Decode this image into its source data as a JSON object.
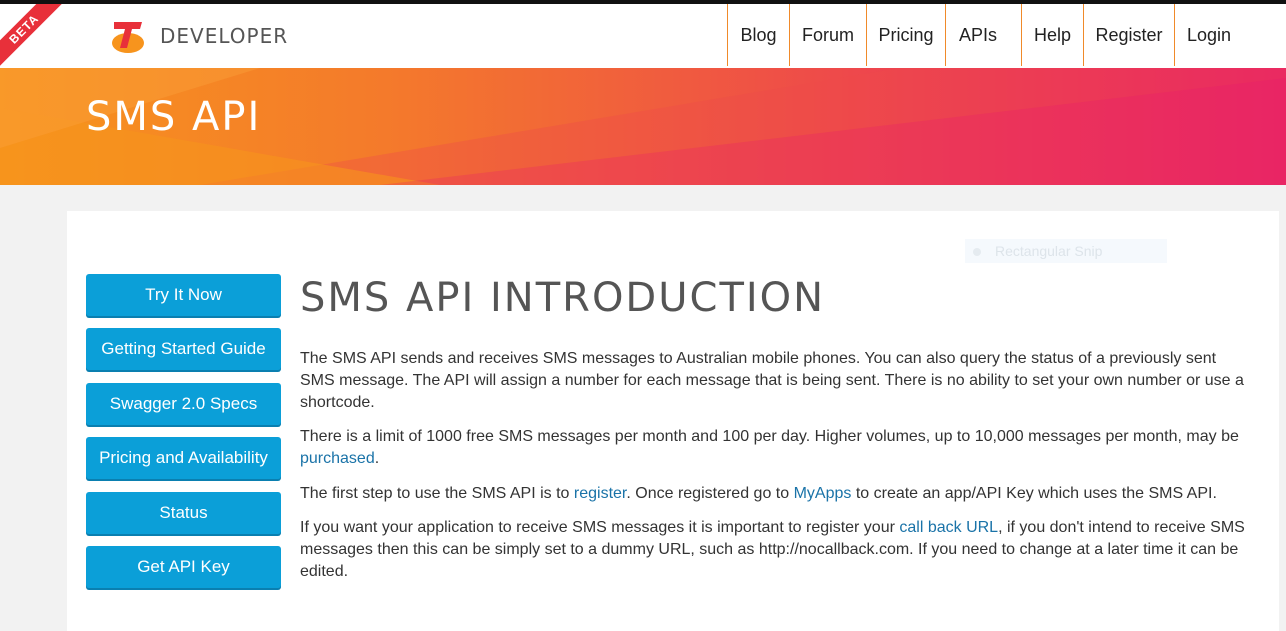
{
  "header": {
    "beta": "BETA",
    "brand": "DEVELOPER",
    "nav": [
      "Blog",
      "Forum",
      "Pricing",
      "APIs",
      "Help",
      "Register",
      "Login"
    ]
  },
  "hero": {
    "title": "SMS API"
  },
  "snip_overlay": {
    "label": "Rectangular Snip"
  },
  "sidebar": {
    "buttons": [
      "Try It Now",
      "Getting Started Guide",
      "Swagger 2.0 Specs",
      "Pricing and Availability",
      "Status",
      "Get API Key"
    ]
  },
  "content": {
    "title": "SMS API INTRODUCTION",
    "p1": "The SMS API sends and receives SMS messages to Australian mobile phones. You can also query the status of a previously sent SMS message. The API will assign a number for each message that is being sent. There is no ability to set your own number or use a shortcode.",
    "p2_text": "There is a limit of 1000 free SMS messages per month and 100 per day. Higher volumes, up to 10,000 messages per month, may be ",
    "p2_link": "purchased",
    "p2_end": ".",
    "p3_a": "The first step to use the SMS API is to ",
    "p3_link1": "register",
    "p3_b": ". Once registered go to ",
    "p3_link2": "MyApps",
    "p3_c": " to create an app/API Key which uses the SMS API.",
    "p4_a": "If you want your application to receive SMS messages it is important to register your ",
    "p4_link": "call back URL",
    "p4_b": ", if you don't intend to receive SMS messages then this can be simply set to a dummy URL, such as http://nocallback.com. If you need to change at a later time it can be edited."
  },
  "colors": {
    "accent_blue": "#0b9fd8",
    "nav_border": "#f08a2a",
    "brand_red": "#e8303a"
  }
}
